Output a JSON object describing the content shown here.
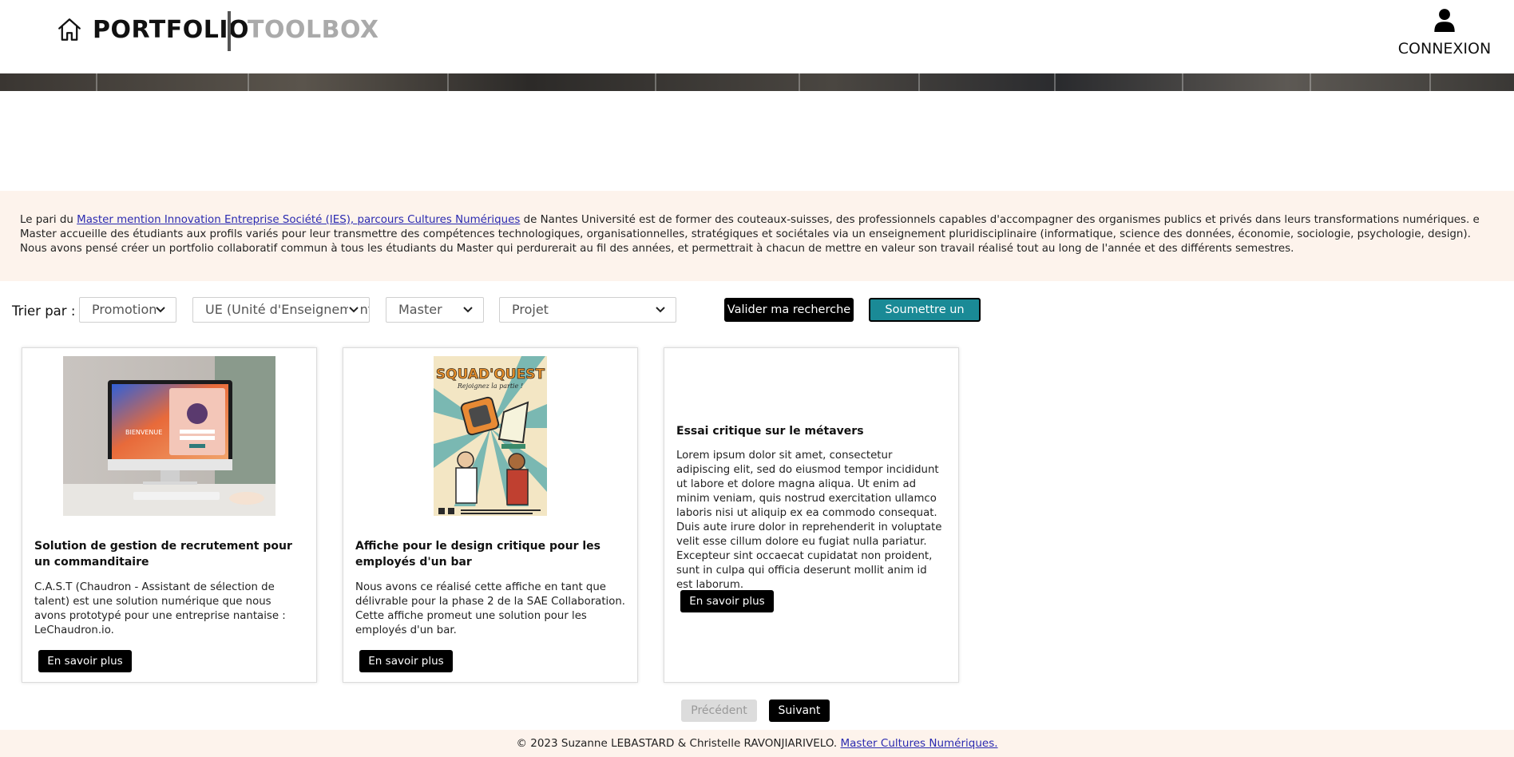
{
  "header": {
    "home_icon": "home-icon",
    "brand": "PORTFOLIO",
    "toolbox": "TOOLBOX",
    "login_icon": "user-icon",
    "login_label": "CONNEXION"
  },
  "intro": {
    "line1_prefix": "Le pari du ",
    "line1_link": "Master mention Innovation Entreprise Société (IES), parcours Cultures Numériques",
    "line1_suffix": " de Nantes Université est de former des couteaux-suisses, des professionnels capables d'accompagner des organismes publics et privés dans leurs transformations numériques. e Master accueille des étudiants aux profils variés pour leur transmettre des compétences technologiques, organisationnelles, stratégiques et sociétales via un enseignement pluridisciplinaire (informatique, science des données, économie, sociologie, psychologie, design).",
    "line2": "Nous avons pensé créer un portfolio collaboratif commun à tous les étudiants du Master qui perdurerait au fil des années, et permettrait à chacun de mettre en valeur son travail réalisé tout au long de l'année et des différents semestres."
  },
  "filters": {
    "sort_label": "Trier par :",
    "selects": [
      "Promotion",
      "UE (Unité d'Enseignement)",
      "Master",
      "Projet"
    ],
    "validate_label": "Valider ma recherche",
    "submit_label": "Soumettre un projet"
  },
  "cards": [
    {
      "title": "Solution de gestion de recrutement pour un commanditaire",
      "text": "C.A.S.T (Chaudron - Assistant de sélection de talent) est une solution numérique que nous avons prototypé pour une entreprise nantaise : LeChaudron.io.",
      "button": "En savoir plus",
      "image_screen_label": "BIENVENUE"
    },
    {
      "title": "Affiche pour le design critique pour les employés d'un bar",
      "text": "Nous avons ce réalisé cette affiche en tant que délivrable pour la phase 2 de la SAE Collaboration. Cette affiche promeut une solution pour les employés d'un bar.",
      "button": "En savoir plus",
      "poster_title": "SQUAD'QUEST",
      "poster_subtitle": "Rejoignez la partie !"
    },
    {
      "title": "Essai critique sur le métavers",
      "text": "Lorem ipsum dolor sit amet, consectetur adipiscing elit, sed do eiusmod tempor incididunt ut labore et dolore magna aliqua. Ut enim ad minim veniam, quis nostrud exercitation ullamco laboris nisi ut aliquip ex ea commodo consequat. Duis aute irure dolor in reprehenderit in voluptate velit esse cillum dolore eu fugiat nulla pariatur. Excepteur sint occaecat cupidatat non proident, sunt in culpa qui officia deserunt mollit anim id est laborum.",
      "button": "En savoir plus"
    }
  ],
  "pagination": {
    "prev": "Précédent",
    "next": "Suivant"
  },
  "footer": {
    "text": "© 2023 Suzanne LEBASTARD & Christelle RAVONJIARIVELO. ",
    "link": "Master Cultures Numériques."
  },
  "colors": {
    "accent_teal": "#1a8a96",
    "intro_bg": "#fdf3ec",
    "link": "#2a2ab0"
  }
}
